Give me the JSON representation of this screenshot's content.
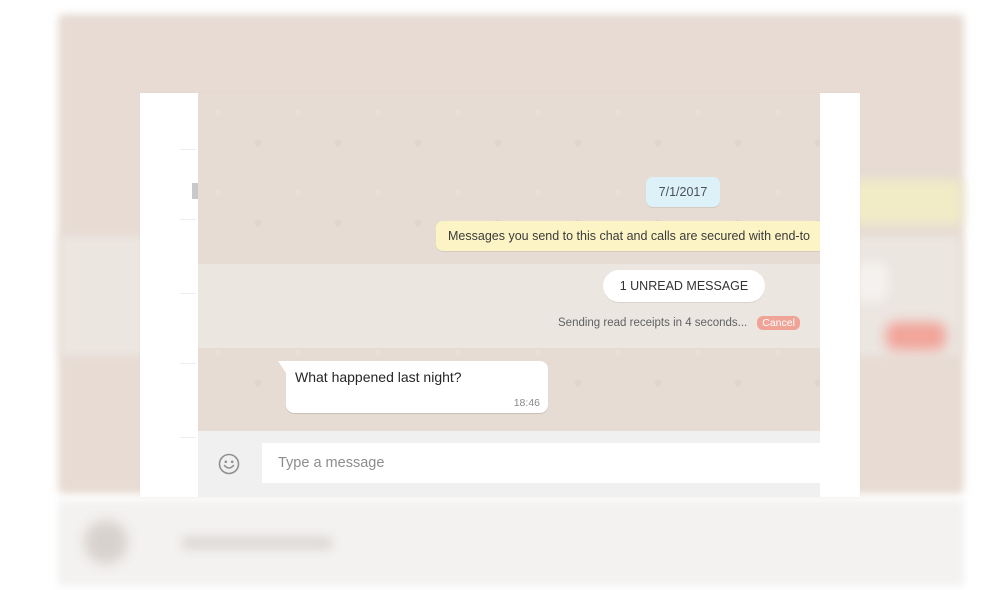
{
  "chat": {
    "date": "7/1/2017",
    "encryption_notice": "Messages you send to this chat and calls are secured with end-to",
    "unread_label": "1 UNREAD MESSAGE",
    "receipts_text": "Sending read receipts in 4 seconds...",
    "cancel_label": "Cancel"
  },
  "message": {
    "text": "What happened last night?",
    "time": "18:46"
  },
  "compose": {
    "placeholder": "Type a message",
    "emoji_icon": "smiley-icon"
  },
  "colors": {
    "chat_bg": "#e6dcd3",
    "date_chip": "#dcf1f8",
    "encryption_bg": "#fdf4c5",
    "cancel_bg": "#f0a497"
  }
}
